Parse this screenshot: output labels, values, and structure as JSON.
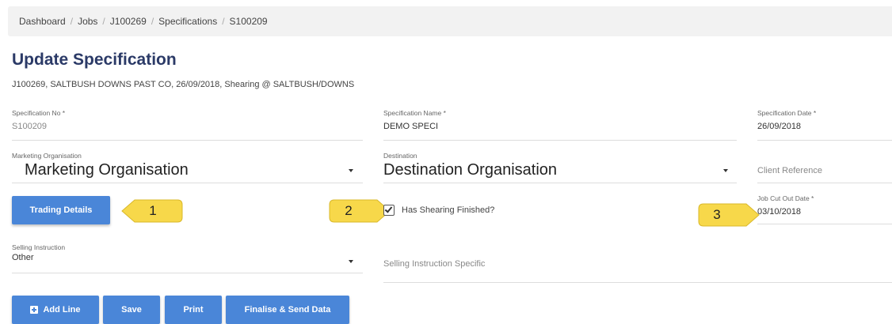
{
  "breadcrumb": {
    "items": [
      "Dashboard",
      "Jobs",
      "J100269",
      "Specifications",
      "S100209"
    ],
    "separator": "/"
  },
  "page": {
    "title": "Update Specification",
    "subtitle": "J100269, SALTBUSH DOWNS PAST CO, 26/09/2018, Shearing @ SALTBUSH/DOWNS"
  },
  "form": {
    "spec_no": {
      "label": "Specification No *",
      "value": "S100209"
    },
    "spec_name": {
      "label": "Specification Name *",
      "value": "DEMO SPECI"
    },
    "spec_date": {
      "label": "Specification Date *",
      "value": "26/09/2018"
    },
    "marketing_org": {
      "label": "Marketing Organisation",
      "value": "Marketing Organisation"
    },
    "destination": {
      "label": "Destination",
      "value": "Destination Organisation"
    },
    "client_reference": {
      "placeholder": "Client Reference"
    },
    "has_shearing_finished": {
      "label": "Has Shearing Finished?",
      "checked": true
    },
    "job_cut_out_date": {
      "label": "Job Cut Out Date *",
      "value": "03/10/2018"
    },
    "selling_instruction": {
      "label": "Selling Instruction",
      "value": "Other"
    },
    "selling_instruction_specific": {
      "placeholder": "Selling Instruction Specific"
    }
  },
  "buttons": {
    "trading_details": "Trading Details",
    "add_line": "Add Line",
    "save": "Save",
    "print": "Print",
    "finalise": "Finalise & Send Data"
  },
  "callouts": [
    "1",
    "2",
    "3"
  ],
  "colors": {
    "primary_button": "#4a86d8",
    "title": "#2b3a67",
    "callout_fill": "#f7d84a"
  }
}
